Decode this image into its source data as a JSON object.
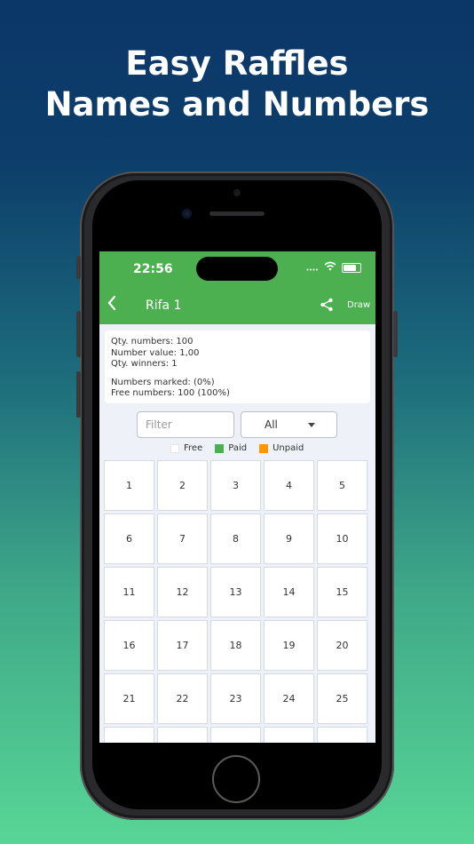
{
  "headline": {
    "line1": "Easy Raffles",
    "line2": "Names and Numbers"
  },
  "status_bar": {
    "time": "22:56"
  },
  "appbar": {
    "back_icon": "chevron-left-icon",
    "title": "Rifa 1",
    "share_icon": "share-icon",
    "draw_label": "Draw",
    "color": "#4caf50"
  },
  "info": {
    "qty_numbers": "Qty. numbers: 100",
    "number_value": "Number value: 1,00",
    "qty_winners": "Qty. winners: 1",
    "numbers_marked": "Numbers marked: (0%)",
    "free_numbers": "Free numbers: 100 (100%)"
  },
  "filter": {
    "placeholder": "Filter",
    "select_value": "All"
  },
  "legend": [
    {
      "label": "Free",
      "color": "#ffffff"
    },
    {
      "label": "Paid",
      "color": "#4caf50"
    },
    {
      "label": "Unpaid",
      "color": "#ff9800"
    }
  ],
  "numbers": [
    "1",
    "2",
    "3",
    "4",
    "5",
    "6",
    "7",
    "8",
    "9",
    "10",
    "11",
    "12",
    "13",
    "14",
    "15",
    "16",
    "17",
    "18",
    "19",
    "20",
    "21",
    "22",
    "23",
    "24",
    "25",
    "",
    "",
    "",
    "",
    ""
  ]
}
